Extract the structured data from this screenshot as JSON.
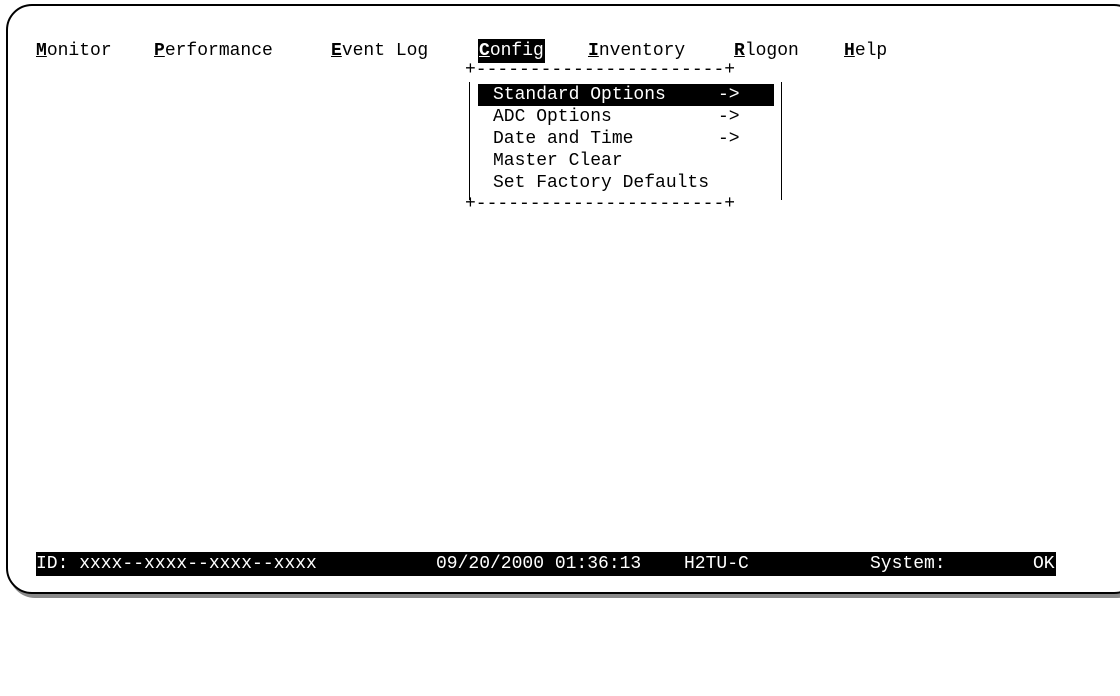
{
  "menubar": {
    "items": [
      {
        "hotkey": "M",
        "rest": "onitor"
      },
      {
        "hotkey": "P",
        "rest": "erformance"
      },
      {
        "hotkey": "E",
        "rest": "vent Log"
      },
      {
        "hotkey": "C",
        "rest": "onfig"
      },
      {
        "hotkey": "I",
        "rest": "nventory"
      },
      {
        "hotkey": "R",
        "rest": "logon"
      },
      {
        "hotkey": "H",
        "rest": "elp"
      }
    ],
    "active": "Config"
  },
  "dropdown": {
    "border_top": "+-----------------------+",
    "border_bottom": "+-----------------------+",
    "options": [
      {
        "label": "Standard Options",
        "arrow": "->"
      },
      {
        "label": "ADC Options",
        "arrow": "->"
      },
      {
        "label": "Date and Time",
        "arrow": "->"
      },
      {
        "label": "Master Clear",
        "arrow": ""
      },
      {
        "label": "Set Factory Defaults",
        "arrow": ""
      }
    ],
    "selected_index": 0
  },
  "status": {
    "id": "ID: xxxx--xxxx--xxxx--xxxx",
    "datetime": "09/20/2000 01:36:13",
    "unit": "H2TU-C",
    "system_label": "System:",
    "system_value": "OK"
  },
  "colors": {
    "foreground": "#000000",
    "background": "#ffffff",
    "highlight": "#000000"
  }
}
